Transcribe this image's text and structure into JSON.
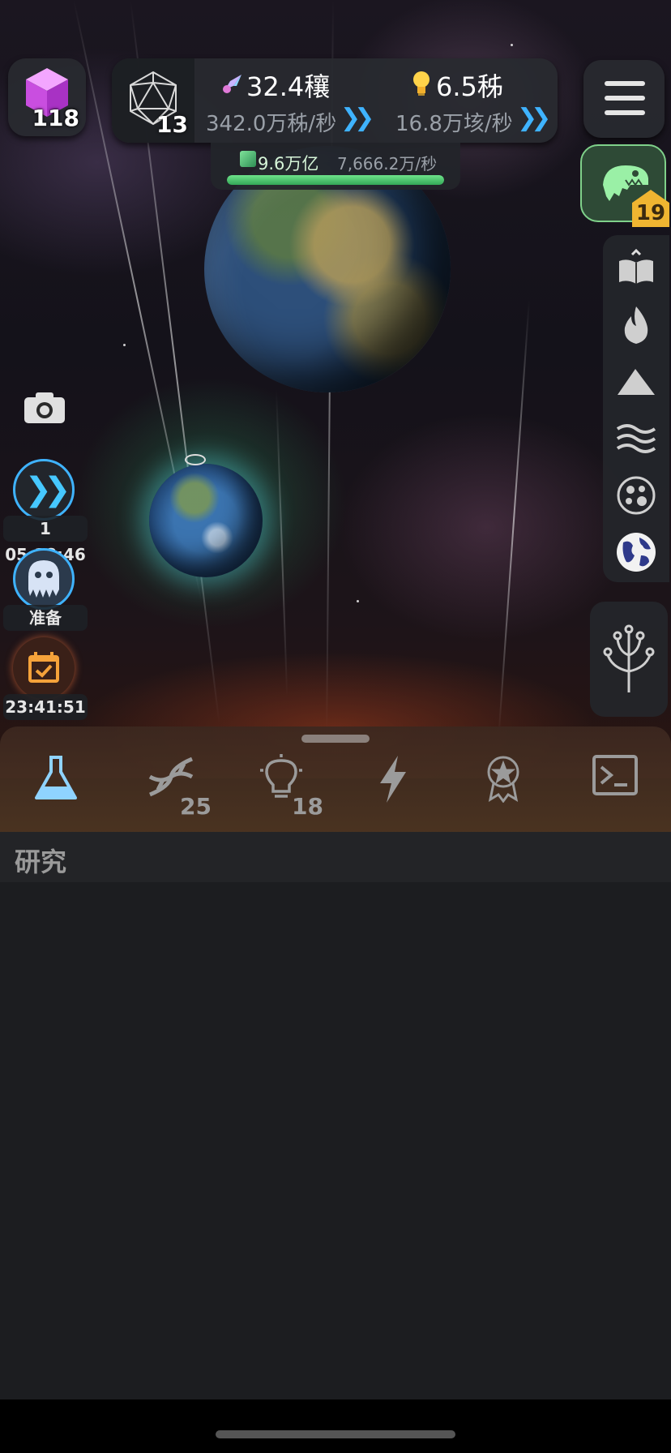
{
  "hud": {
    "cube_count": "118",
    "icosa_count": "13",
    "res1": {
      "icon": "rocket-icon",
      "value": "32.4穰",
      "rate": "342.0万秭/秒"
    },
    "res2": {
      "icon": "lightbulb-icon",
      "value": "6.5秭",
      "rate": "16.8万垓/秒"
    },
    "gems": {
      "icon": "gem-icon",
      "value": "9.6万亿",
      "rate": "7,666.2万/秒",
      "progress": 1.0
    }
  },
  "right_panel": {
    "dino_level": "19",
    "side_tabs": [
      "book-icon",
      "fire-icon",
      "mountain-icon",
      "waves-icon",
      "cells-icon",
      "globe-icon"
    ],
    "active_tab": "globe-icon"
  },
  "left_panel": {
    "speed_timer": "1 05:18:46",
    "ghost_label": "准备",
    "calendar_timer": "23:41:51"
  },
  "bottom_tabs": [
    {
      "icon": "flask-icon",
      "count": ""
    },
    {
      "icon": "dna-icon",
      "count": "25"
    },
    {
      "icon": "lightbulb-icon",
      "count": "18"
    },
    {
      "icon": "lightning-icon",
      "count": ""
    },
    {
      "icon": "medal-icon",
      "count": ""
    },
    {
      "icon": "terminal-icon",
      "count": ""
    }
  ],
  "section_title": "研究",
  "colors": {
    "accent_blue": "#3fb3ff",
    "gem_green": "#4fd06e",
    "panel": "#1c1d20",
    "badge_gold": "#f0b531"
  }
}
